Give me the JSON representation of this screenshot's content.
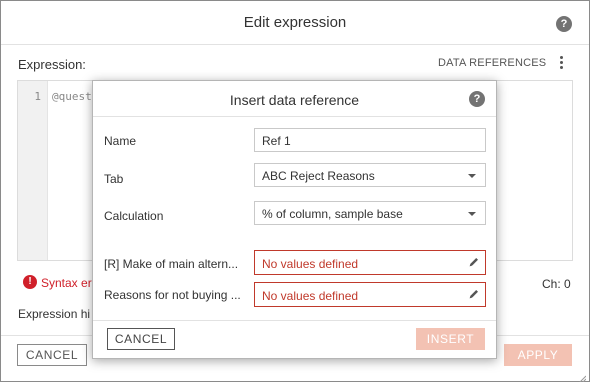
{
  "outer": {
    "title": "Edit expression",
    "help_icon": "help-icon",
    "expression_label": "Expression:",
    "data_references_label": "DATA REFERENCES",
    "menu_icon": "more-vertical-icon",
    "editor": {
      "line_number": "1",
      "text": "@quest"
    },
    "syntax_error": {
      "icon": "error-icon",
      "text": "Syntax err"
    },
    "char_count": "Ch: 0",
    "expression_hint": "Expression hi",
    "cancel_label": "CANCEL",
    "apply_label": "APPLY"
  },
  "modal": {
    "title": "Insert data reference",
    "help_icon": "help-icon",
    "fields": {
      "name": {
        "label": "Name",
        "value": "Ref 1"
      },
      "tab": {
        "label": "Tab",
        "value": "ABC Reject Reasons"
      },
      "calculation": {
        "label": "Calculation",
        "value": "% of column, sample base"
      },
      "ref1": {
        "label": "[R] Make of main altern...",
        "value": "No values defined"
      },
      "ref2": {
        "label": "Reasons for not buying ...",
        "value": "No values defined"
      }
    },
    "cancel_label": "CANCEL",
    "insert_label": "INSERT"
  },
  "colors": {
    "error": "#c0392b",
    "disabled_accent": "#f3c2b3",
    "help_icon_bg": "#737373"
  }
}
